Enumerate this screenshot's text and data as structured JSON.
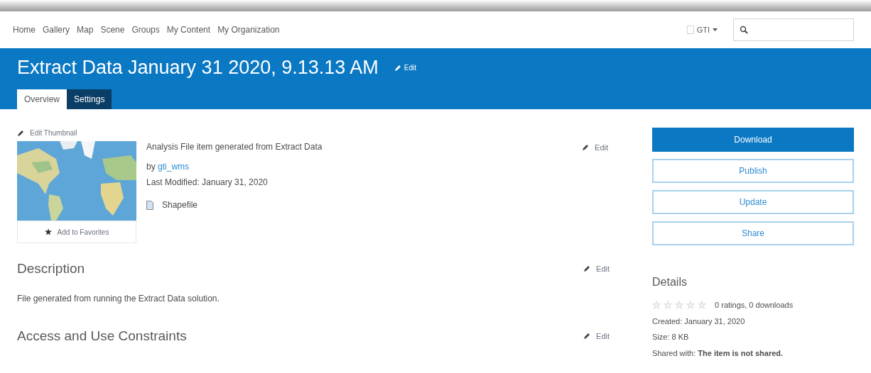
{
  "nav": {
    "links": [
      "Home",
      "Gallery",
      "Map",
      "Scene",
      "Groups",
      "My Content",
      "My Organization"
    ],
    "user": "GTI"
  },
  "header": {
    "title": "Extract Data January 31 2020, 9.13.13 AM",
    "edit": "Edit"
  },
  "tabs": [
    {
      "label": "Overview",
      "selected": true
    },
    {
      "label": "Settings",
      "selected": false
    }
  ],
  "summary": {
    "edit_thumbnail": "Edit Thumbnail",
    "favorites": "Add to Favorites",
    "text": "Analysis File item generated from Extract Data",
    "by": "by",
    "owner": "gti_wms",
    "modified": "Last Modified: January 31, 2020",
    "type": "Shapefile",
    "edit": "Edit"
  },
  "sections": [
    {
      "title": "Description",
      "edit": "Edit",
      "body": "File generated from running the Extract Data solution."
    },
    {
      "title": "Access and Use Constraints",
      "edit": "Edit"
    }
  ],
  "actions": [
    {
      "label": "Download",
      "kind": "primary"
    },
    {
      "label": "Publish",
      "kind": "outline"
    },
    {
      "label": "Update",
      "kind": "outline"
    },
    {
      "label": "Share",
      "kind": "outline"
    }
  ],
  "details": {
    "title": "Details",
    "stars": 0,
    "ratings": "0 ratings, 0 downloads",
    "lines": [
      "Created: January 31, 2020",
      "Size: 8 KB",
      "Shared with: **The item is not shared.**"
    ]
  }
}
